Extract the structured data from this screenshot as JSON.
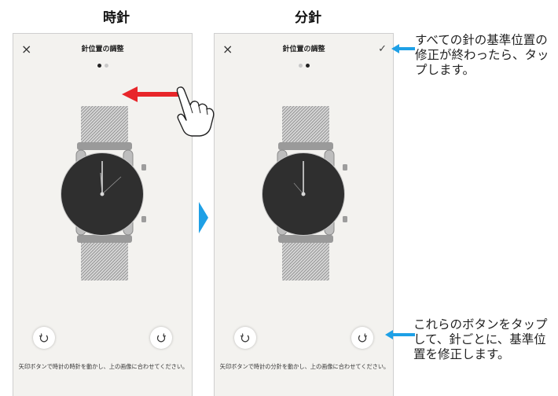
{
  "columns": {
    "left_title": "時針",
    "right_title": "分針"
  },
  "screens": [
    {
      "header_title": "針位置の調整",
      "close_label": "×",
      "instruction": "矢印ボタンで時計の時針を動かし、上の画像に合わせてください。",
      "active_dot": 0
    },
    {
      "header_title": "針位置の調整",
      "close_label": "×",
      "confirm_label": "✓",
      "instruction": "矢印ボタンで時計の分針を動かし、上の画像に合わせてください。",
      "active_dot": 1
    }
  ],
  "annotations": {
    "confirm_note": "すべての針の基準位置の修正が終わったら、タップします。",
    "buttons_note": "これらのボタンをタップして、針ごとに、基準位置を修正します。"
  },
  "icons": {
    "close": "close-icon",
    "confirm": "checkmark-icon",
    "rotate_ccw": "rotate-counterclockwise-icon",
    "rotate_cw": "rotate-clockwise-icon",
    "swipe": "hand-swipe-icon",
    "next": "next-triangle-icon"
  },
  "colors": {
    "callout_blue": "#1ea0e6",
    "swipe_red": "#e8262a",
    "watch_face": "#2f2f2f",
    "screen_bg": "#f3f2ef"
  }
}
